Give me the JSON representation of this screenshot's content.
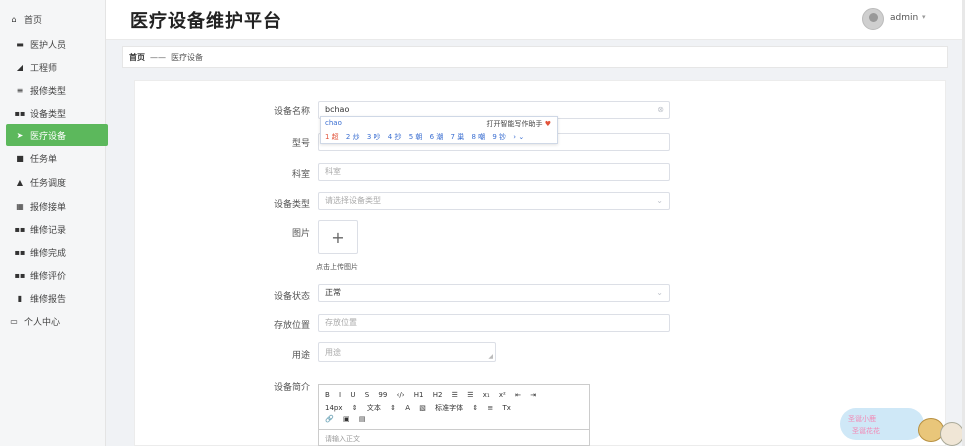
{
  "sidebar": {
    "items": [
      {
        "label": "首页",
        "icon": "home-icon",
        "glyph": "⌂"
      },
      {
        "label": "医护人员",
        "icon": "card-icon",
        "glyph": "▬"
      },
      {
        "label": "工程师",
        "icon": "hammer-icon",
        "glyph": "◢"
      },
      {
        "label": "报修类型",
        "icon": "menu-icon",
        "glyph": "≡"
      },
      {
        "label": "设备类型",
        "icon": "grid-icon",
        "glyph": "▪▪"
      },
      {
        "label": "医疗设备",
        "icon": "send-icon",
        "glyph": "➤"
      },
      {
        "label": "任务单",
        "icon": "checkbox-icon",
        "glyph": "■"
      },
      {
        "label": "任务调度",
        "icon": "person-icon",
        "glyph": "▲"
      },
      {
        "label": "报修接单",
        "icon": "table-icon",
        "glyph": "▦"
      },
      {
        "label": "维修记录",
        "icon": "grid-icon",
        "glyph": "▪▪"
      },
      {
        "label": "维修完成",
        "icon": "grid-icon",
        "glyph": "▪▪"
      },
      {
        "label": "维修评价",
        "icon": "grid-icon",
        "glyph": "▪▪"
      },
      {
        "label": "维修报告",
        "icon": "doc-icon",
        "glyph": "▮"
      },
      {
        "label": "个人中心",
        "icon": "monitor-icon",
        "glyph": "▭"
      }
    ]
  },
  "header": {
    "title": "医疗设备维护平台",
    "user": "admin",
    "caret": "▾"
  },
  "breadcrumb": {
    "home": "首页",
    "separator": "——",
    "current": "医疗设备"
  },
  "form": {
    "name_label": "设备名称",
    "name_value": "bchao",
    "clear_glyph": "⊗",
    "model_label": "型号",
    "dept_label": "科室",
    "dept_placeholder": "科室",
    "type_label": "设备类型",
    "type_placeholder": "请选择设备类型",
    "image_label": "图片",
    "upload_plus": "+",
    "upload_hint": "点击上传图片",
    "status_label": "设备状态",
    "status_value": "正常",
    "location_label": "存放位置",
    "location_placeholder": "存放位置",
    "usage_label": "用途",
    "usage_placeholder": "用途",
    "intro_label": "设备简介",
    "chevron": "⌄"
  },
  "ime": {
    "composition": "chao",
    "tip": "打开智能写作助手",
    "tip_dot": "♥",
    "candidates": [
      "1 超",
      "2 炒",
      "3 吵",
      "4 抄",
      "5 朝",
      "6 潮",
      "7 巢",
      "8 嘲",
      "9 钞",
      "› ⌄"
    ]
  },
  "editor": {
    "row1": [
      "B",
      "I",
      "U",
      "S",
      "99",
      "‹/›",
      "H1",
      "H2",
      "☰",
      "☰",
      "x₁",
      "x²",
      "⇤",
      "⇥"
    ],
    "row2": [
      "14px",
      "⇕",
      "文本",
      "⇕",
      "A",
      "▧",
      "标准字体",
      "⇕",
      "≡",
      "Tx"
    ],
    "row3": [
      "🔗",
      "▣",
      "▤"
    ],
    "placeholder": "请输入正文"
  },
  "mascot": {
    "line1": "圣诞小鹿",
    "line2": "圣诞花花"
  }
}
